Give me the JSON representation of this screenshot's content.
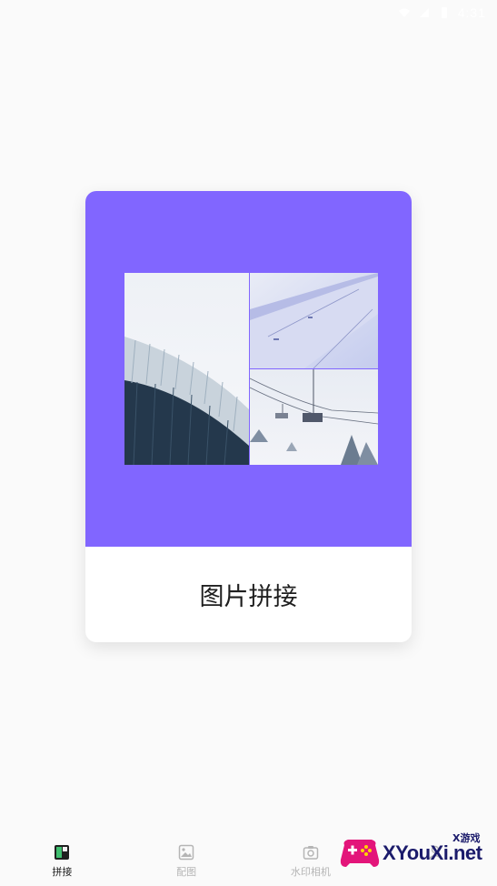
{
  "status_bar": {
    "time": "4:31",
    "icons": [
      "wifi-icon",
      "signal-icon",
      "battery-icon"
    ]
  },
  "card": {
    "title": "图片拼接",
    "accent_color": "#8166ff",
    "images": [
      "building-photo",
      "airplane-wing-photo",
      "ski-lift-photo"
    ]
  },
  "tabs": [
    {
      "label": "拼接",
      "icon": "collage-icon",
      "active": true
    },
    {
      "label": "配图",
      "icon": "image-icon",
      "active": false
    },
    {
      "label": "水印相机",
      "icon": "camera-icon",
      "active": false
    },
    {
      "label": "",
      "icon": "mine-icon",
      "active": false
    }
  ],
  "watermark": {
    "small": "X游戏",
    "text": "XYouXi.net"
  }
}
